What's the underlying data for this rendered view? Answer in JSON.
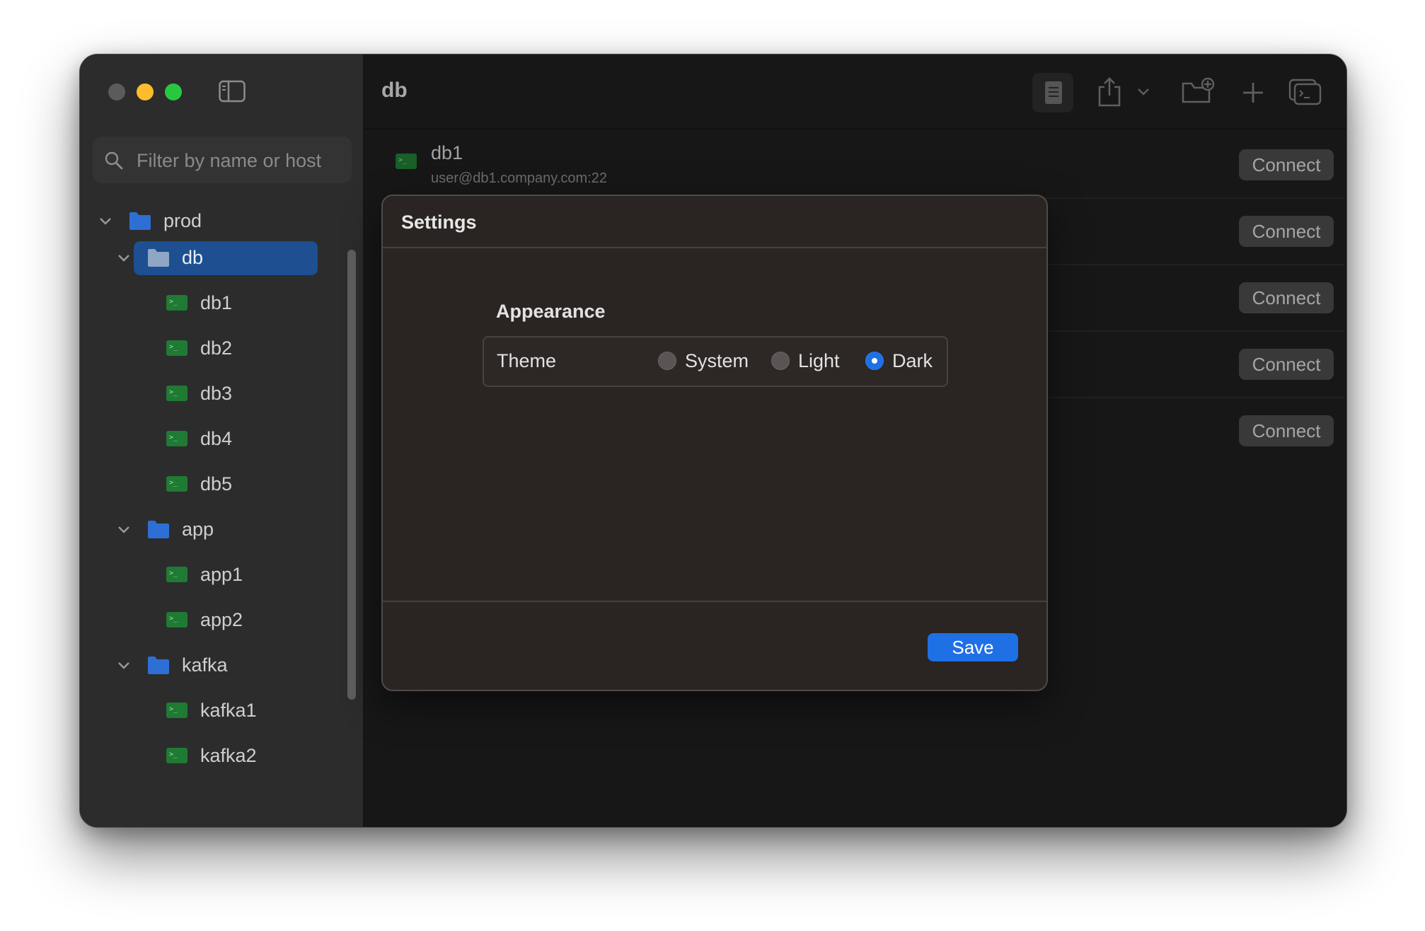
{
  "window": {
    "title": "db"
  },
  "search": {
    "placeholder": "Filter by name or host"
  },
  "sidebar": {
    "tree": [
      {
        "label": "prod",
        "type": "folder"
      },
      {
        "label": "db",
        "type": "folder",
        "selected": true
      },
      {
        "label": "db1",
        "type": "host"
      },
      {
        "label": "db2",
        "type": "host"
      },
      {
        "label": "db3",
        "type": "host"
      },
      {
        "label": "db4",
        "type": "host"
      },
      {
        "label": "db5",
        "type": "host"
      },
      {
        "label": "app",
        "type": "folder"
      },
      {
        "label": "app1",
        "type": "host"
      },
      {
        "label": "app2",
        "type": "host"
      },
      {
        "label": "kafka",
        "type": "folder"
      },
      {
        "label": "kafka1",
        "type": "host"
      },
      {
        "label": "kafka2",
        "type": "host"
      }
    ]
  },
  "toolbar": {
    "icons": [
      "notes-icon",
      "share-icon",
      "new-folder-icon",
      "plus-icon",
      "terminal-windows-icon"
    ]
  },
  "hosts": [
    {
      "name": "db1",
      "address": "user@db1.company.com:22",
      "action": "Connect"
    },
    {
      "name": "",
      "address": "",
      "action": "Connect"
    },
    {
      "name": "",
      "address": "",
      "action": "Connect"
    },
    {
      "name": "",
      "address": "",
      "action": "Connect"
    },
    {
      "name": "",
      "address": "",
      "action": "Connect"
    }
  ],
  "settings": {
    "title": "Settings",
    "section": "Appearance",
    "theme_label": "Theme",
    "options": [
      "System",
      "Light",
      "Dark"
    ],
    "selected": "Dark",
    "save_label": "Save"
  },
  "colors": {
    "accent": "#1f6fe5",
    "folder": "#2d6fd4",
    "host_icon": "#1f7a34",
    "traffic_close": "#5b5b5b",
    "traffic_min": "#fcbc2e",
    "traffic_max": "#27c840"
  }
}
